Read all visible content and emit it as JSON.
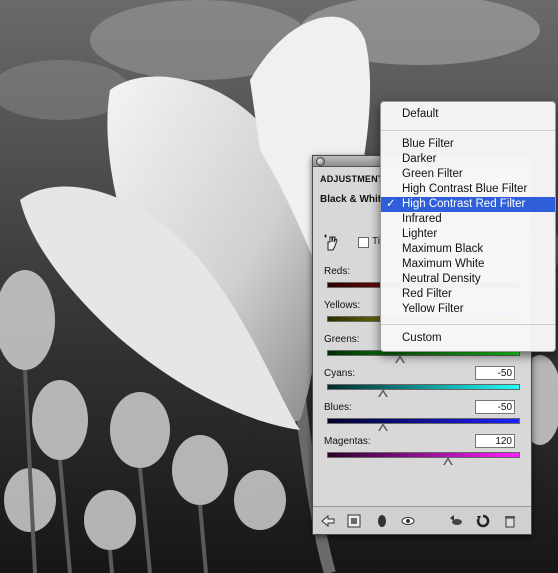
{
  "panel": {
    "tab_title": "ADJUSTMENT",
    "preset_name": "Black & White",
    "tint_label": "Ti",
    "sliders": [
      {
        "label": "Reds:",
        "value": "",
        "colors": [
          "#2a0000",
          "#ff2020"
        ]
      },
      {
        "label": "Yellows:",
        "value": "",
        "colors": [
          "#2a2a00",
          "#ffff20"
        ]
      },
      {
        "label": "Greens:",
        "value": "",
        "colors": [
          "#002a00",
          "#20ff20"
        ]
      },
      {
        "label": "Cyans:",
        "value": "-50",
        "colors": [
          "#002a2a",
          "#20ffff"
        ]
      },
      {
        "label": "Blues:",
        "value": "-50",
        "colors": [
          "#00002a",
          "#2020ff"
        ]
      },
      {
        "label": "Magentas:",
        "value": "120",
        "colors": [
          "#2a002a",
          "#ff20ff"
        ]
      }
    ]
  },
  "footer_icons": [
    "back-arrow-icon",
    "clip-layer-icon",
    "mask-icon",
    "visibility-eye-icon",
    "previous-state-icon",
    "reset-icon",
    "trash-icon"
  ],
  "menu": {
    "default": "Default",
    "items": [
      "Blue Filter",
      "Darker",
      "Green Filter",
      "High Contrast Blue Filter",
      "High Contrast Red Filter",
      "Infrared",
      "Lighter",
      "Maximum Black",
      "Maximum White",
      "Neutral Density",
      "Red Filter",
      "Yellow Filter"
    ],
    "selected_index": 4,
    "custom": "Custom",
    "check_mark": "✓",
    "highlight_color": "#2f5fd8"
  }
}
